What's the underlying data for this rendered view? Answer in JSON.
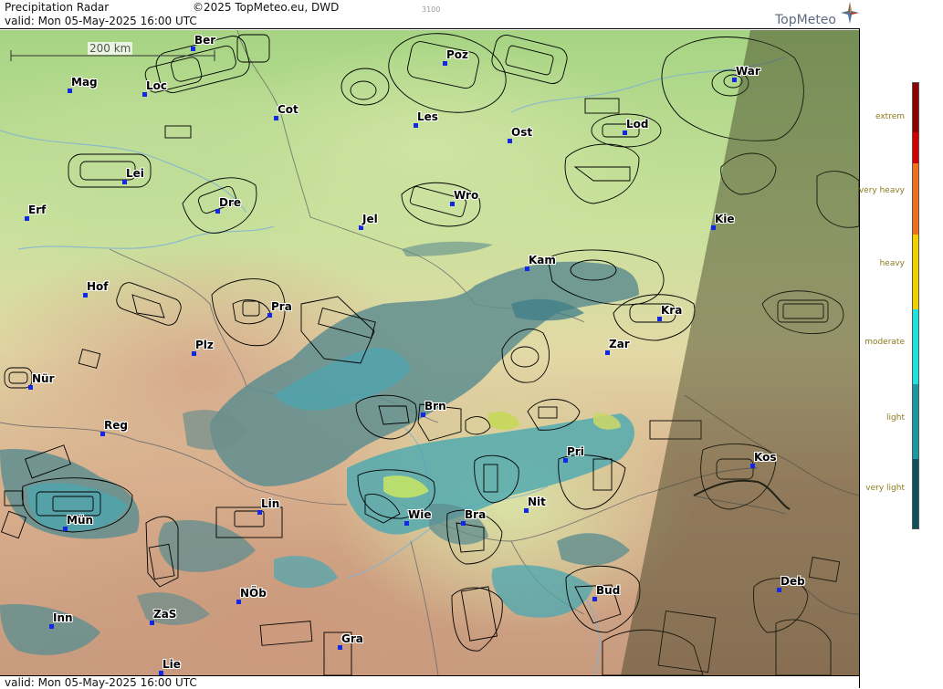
{
  "header": {
    "title": "Precipitation Radar",
    "copyright": "©2025 TopMeteo.eu, DWD",
    "code": "3100",
    "valid": "valid:  Mon  05-May-2025 16:00 UTC",
    "brand": "TopMeteo"
  },
  "footer": {
    "valid": "valid:  Mon  05-May-2025 16:00 UTC"
  },
  "map": {
    "scale_label": "200 km",
    "cities": [
      {
        "name": "Ber"
      },
      {
        "name": "Mag"
      },
      {
        "name": "Loc"
      },
      {
        "name": "Cot"
      },
      {
        "name": "Poz"
      },
      {
        "name": "War"
      },
      {
        "name": "Les"
      },
      {
        "name": "Ost"
      },
      {
        "name": "Lod"
      },
      {
        "name": "Lei"
      },
      {
        "name": "Dre"
      },
      {
        "name": "Wro"
      },
      {
        "name": "Erf"
      },
      {
        "name": "Jel"
      },
      {
        "name": "Kie"
      },
      {
        "name": "Kam"
      },
      {
        "name": "Hof"
      },
      {
        "name": "Pra"
      },
      {
        "name": "Kra"
      },
      {
        "name": "Plz"
      },
      {
        "name": "Zar"
      },
      {
        "name": "Nür"
      },
      {
        "name": "Brn"
      },
      {
        "name": "Reg"
      },
      {
        "name": "Pri"
      },
      {
        "name": "Kos"
      },
      {
        "name": "Lin"
      },
      {
        "name": "Nit"
      },
      {
        "name": "Mün"
      },
      {
        "name": "Wie"
      },
      {
        "name": "Bra"
      },
      {
        "name": "Bud"
      },
      {
        "name": "Deb"
      },
      {
        "name": "NÖb"
      },
      {
        "name": "ZaS"
      },
      {
        "name": "Inn"
      },
      {
        "name": "Gra"
      },
      {
        "name": "Lie"
      }
    ]
  },
  "legend": {
    "labels": [
      "extrem",
      "very heavy",
      "heavy",
      "moderate",
      "light",
      "very light"
    ],
    "colors": [
      "#8b0000",
      "#d40000",
      "#f07020",
      "#f0d000",
      "#20e0e0",
      "#1a9aa0",
      "#0e4f5c"
    ]
  }
}
